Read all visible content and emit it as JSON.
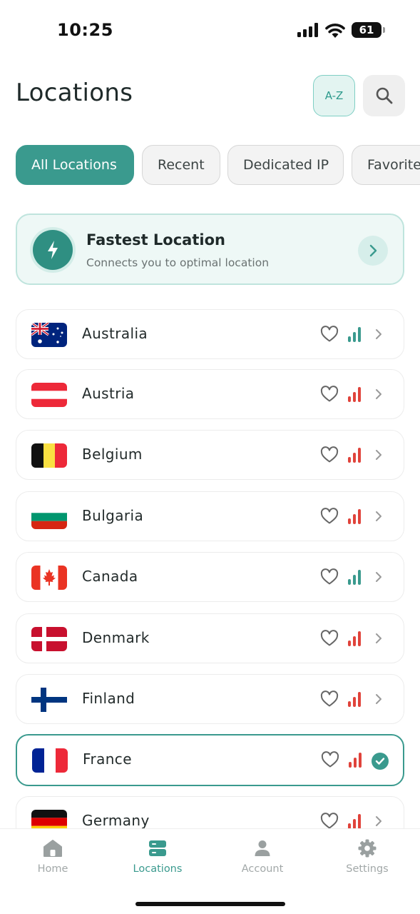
{
  "status_bar": {
    "time": "10:25",
    "battery": "61",
    "icons": [
      "signal-icon",
      "wifi-icon",
      "battery-icon"
    ]
  },
  "header": {
    "title": "Locations",
    "sort_label": "A-Z",
    "search_icon": "search-icon"
  },
  "tabs": [
    {
      "label": "All Locations",
      "active": true
    },
    {
      "label": "Recent",
      "active": false
    },
    {
      "label": "Dedicated IP",
      "active": false
    },
    {
      "label": "Favorites",
      "active": false
    }
  ],
  "fastest": {
    "title": "Fastest Location",
    "subtitle": "Connects you to optimal location",
    "icon": "lightning-icon"
  },
  "locations": [
    {
      "name": "Australia",
      "flag": "australia-flag",
      "signal_color": "#3a9a8e",
      "favorite": false,
      "selected": false
    },
    {
      "name": "Austria",
      "flag": "austria-flag",
      "signal_color": "#e0433b",
      "favorite": false,
      "selected": false
    },
    {
      "name": "Belgium",
      "flag": "belgium-flag",
      "signal_color": "#e0433b",
      "favorite": false,
      "selected": false
    },
    {
      "name": "Bulgaria",
      "flag": "bulgaria-flag",
      "signal_color": "#e0433b",
      "favorite": false,
      "selected": false
    },
    {
      "name": "Canada",
      "flag": "canada-flag",
      "signal_color": "#3a9a8e",
      "favorite": false,
      "selected": false
    },
    {
      "name": "Denmark",
      "flag": "denmark-flag",
      "signal_color": "#e0433b",
      "favorite": false,
      "selected": false
    },
    {
      "name": "Finland",
      "flag": "finland-flag",
      "signal_color": "#e0433b",
      "favorite": false,
      "selected": false
    },
    {
      "name": "France",
      "flag": "france-flag",
      "signal_color": "#e0433b",
      "favorite": false,
      "selected": true
    },
    {
      "name": "Germany",
      "flag": "germany-flag",
      "signal_color": "#e0433b",
      "favorite": false,
      "selected": false
    }
  ],
  "bottom_nav": [
    {
      "label": "Home",
      "icon": "home-icon",
      "active": false
    },
    {
      "label": "Locations",
      "icon": "server-icon",
      "active": true
    },
    {
      "label": "Account",
      "icon": "person-icon",
      "active": false
    },
    {
      "label": "Settings",
      "icon": "gear-icon",
      "active": false
    }
  ],
  "colors": {
    "accent": "#3a9a8e",
    "signal_good": "#3a9a8e",
    "signal_weak": "#e0433b"
  }
}
